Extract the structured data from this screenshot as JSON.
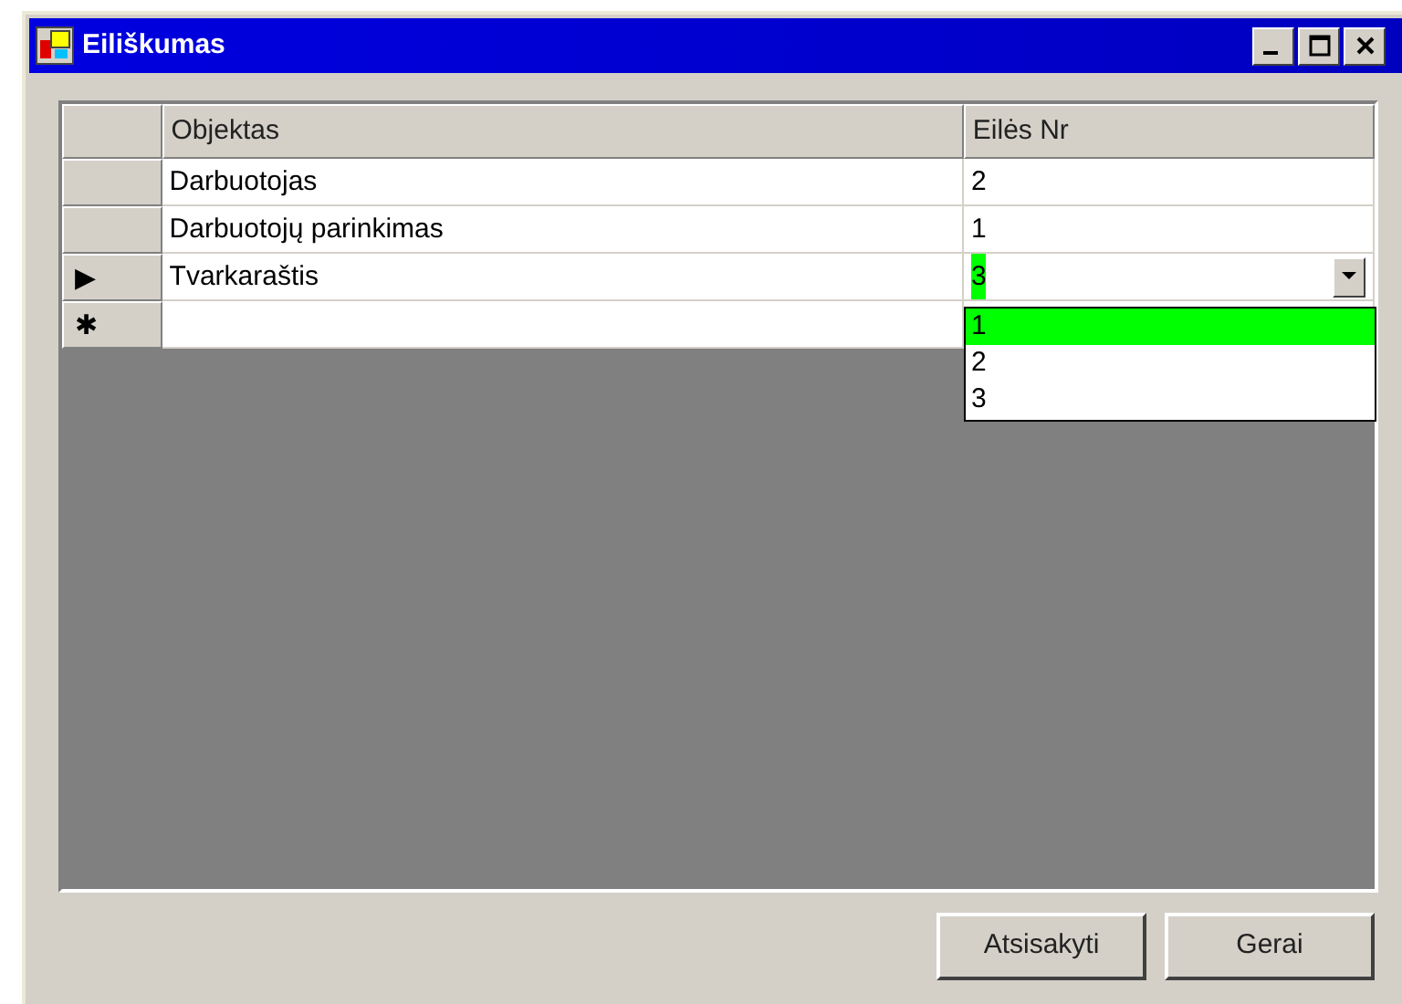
{
  "window": {
    "title": "Eiliškumas"
  },
  "grid": {
    "columns": [
      "Objektas",
      "Eilės Nr"
    ],
    "rows": [
      {
        "marker": "",
        "cells": [
          "Darbuotojas",
          "2"
        ],
        "editing": false
      },
      {
        "marker": "",
        "cells": [
          "Darbuotojų parinkimas",
          "1"
        ],
        "editing": false
      },
      {
        "marker": "▶",
        "cells": [
          "Tvarkaraštis",
          "3"
        ],
        "editing": true
      },
      {
        "marker": "✱",
        "cells": [
          "",
          ""
        ],
        "editing": false
      }
    ]
  },
  "dropdown": {
    "options": [
      {
        "label": "1",
        "selected": true
      },
      {
        "label": "2",
        "selected": false
      },
      {
        "label": "3",
        "selected": false
      }
    ]
  },
  "buttons": [
    "Atsisakyti",
    "Gerai"
  ]
}
